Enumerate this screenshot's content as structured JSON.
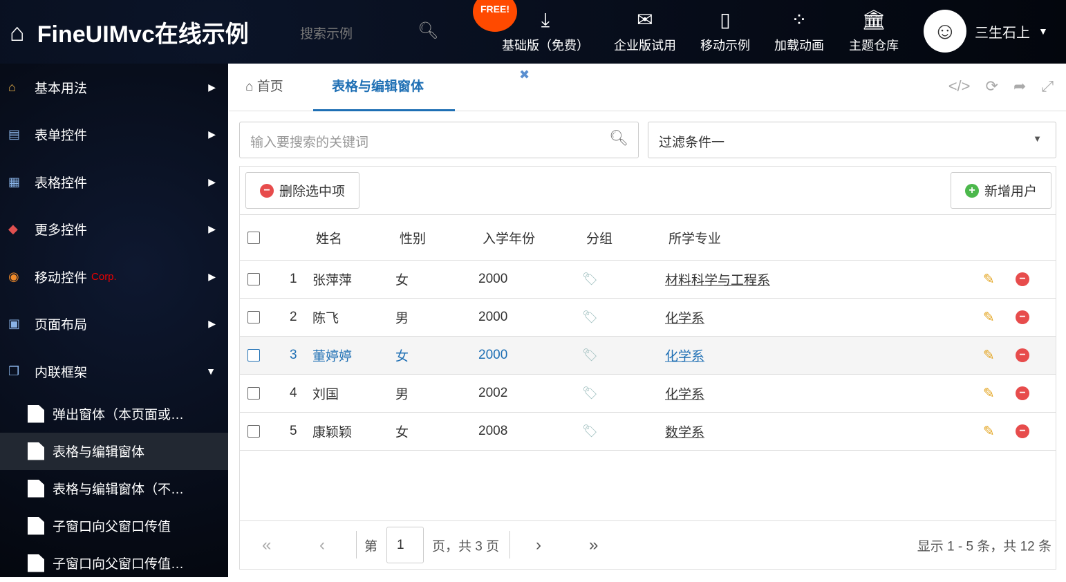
{
  "header": {
    "title": "FineUIMvc在线示例",
    "search_placeholder": "搜索示例",
    "free_badge": "FREE!",
    "nav": [
      {
        "label": "基础版（免费）",
        "icon": "download-icon"
      },
      {
        "label": "企业版试用",
        "icon": "envelope-icon"
      },
      {
        "label": "移动示例",
        "icon": "mobile-icon"
      },
      {
        "label": "加载动画",
        "icon": "spinner-icon"
      },
      {
        "label": "主题仓库",
        "icon": "bank-icon"
      }
    ],
    "user": "三生石上"
  },
  "sidebar": {
    "items": [
      {
        "label": "基本用法"
      },
      {
        "label": "表单控件"
      },
      {
        "label": "表格控件"
      },
      {
        "label": "更多控件"
      },
      {
        "label": "移动控件",
        "badge": "Corp."
      },
      {
        "label": "页面布局"
      },
      {
        "label": "内联框架"
      }
    ],
    "subitems": [
      {
        "label": "弹出窗体（本页面或…"
      },
      {
        "label": "表格与编辑窗体"
      },
      {
        "label": "表格与编辑窗体（不…"
      },
      {
        "label": "子窗口向父窗口传值"
      },
      {
        "label": "子窗口向父窗口传值…"
      }
    ]
  },
  "tabs": [
    {
      "label": "首页"
    },
    {
      "label": "表格与编辑窗体"
    }
  ],
  "filters": {
    "search_placeholder": "输入要搜索的关键词",
    "select_value": "过滤条件一"
  },
  "toolbar": {
    "delete": "删除选中项",
    "add": "新增用户"
  },
  "grid": {
    "columns": [
      "姓名",
      "性别",
      "入学年份",
      "分组",
      "所学专业"
    ],
    "rows": [
      {
        "no": "1",
        "name": "张萍萍",
        "gender": "女",
        "year": "2000",
        "major": "材料科学与工程系"
      },
      {
        "no": "2",
        "name": "陈飞",
        "gender": "男",
        "year": "2000",
        "major": "化学系"
      },
      {
        "no": "3",
        "name": "董婷婷",
        "gender": "女",
        "year": "2000",
        "major": "化学系"
      },
      {
        "no": "4",
        "name": "刘国",
        "gender": "男",
        "year": "2002",
        "major": "化学系"
      },
      {
        "no": "5",
        "name": "康颖颖",
        "gender": "女",
        "year": "2008",
        "major": "数学系"
      }
    ]
  },
  "pager": {
    "page_prefix": "第",
    "page": "1",
    "page_suffix": "页，共 3 页",
    "summary": "显示 1 - 5 条，共 12 条"
  }
}
